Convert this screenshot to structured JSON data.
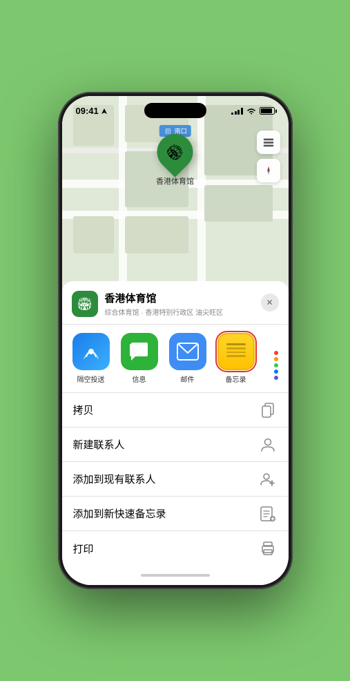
{
  "status": {
    "time": "09:41",
    "location_arrow": "▶"
  },
  "map": {
    "location_label": "南口",
    "location_prefix": "回",
    "pin_label": "香港体育馆",
    "pin_emoji": "🏟"
  },
  "map_controls": {
    "layers_icon": "🗺",
    "compass_icon": "⊕"
  },
  "place": {
    "name": "香港体育馆",
    "subtitle": "综合体育馆 · 香港特别行政区 油尖旺区",
    "icon_emoji": "🏟"
  },
  "share_items": [
    {
      "id": "airdrop",
      "label": "隔空投送",
      "emoji": "📡"
    },
    {
      "id": "messages",
      "label": "信息",
      "emoji": "💬"
    },
    {
      "id": "mail",
      "label": "邮件",
      "emoji": "✉️"
    },
    {
      "id": "notes",
      "label": "备忘录",
      "selected": true
    }
  ],
  "more_dots_colors": [
    "#ff3b30",
    "#ff9500",
    "#34c759",
    "#007aff",
    "#5856d6"
  ],
  "actions": [
    {
      "id": "copy",
      "label": "拷贝"
    },
    {
      "id": "new-contact",
      "label": "新建联系人"
    },
    {
      "id": "add-to-contact",
      "label": "添加到现有联系人"
    },
    {
      "id": "add-to-notes",
      "label": "添加到新快速备忘录"
    },
    {
      "id": "print",
      "label": "打印"
    }
  ]
}
